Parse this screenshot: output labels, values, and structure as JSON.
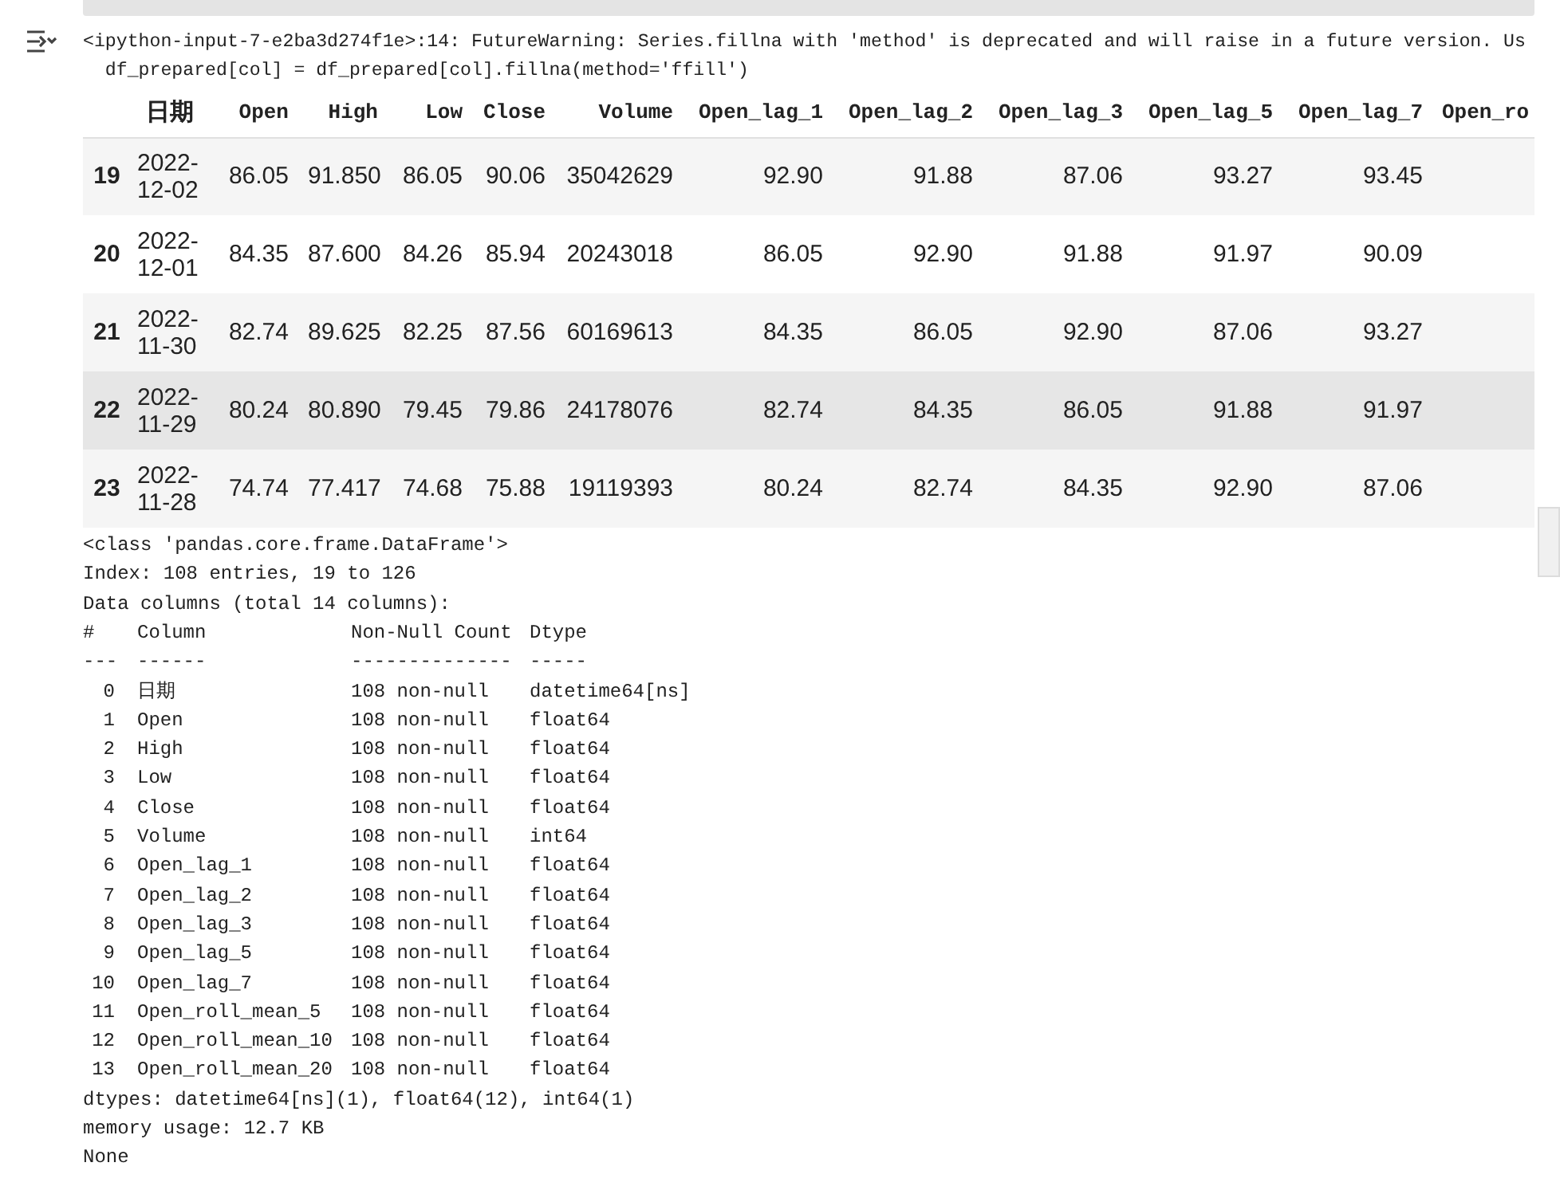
{
  "warning": {
    "lines": [
      "<ipython-input-7-e2ba3d274f1e>:14: FutureWarning: Series.fillna with 'method' is deprecated and will raise in a future version. Us",
      "  df_prepared[col] = df_prepared[col].fillna(method='ffill')"
    ]
  },
  "table": {
    "columns": [
      "",
      "日期",
      "Open",
      "High",
      "Low",
      "Close",
      "Volume",
      "Open_lag_1",
      "Open_lag_2",
      "Open_lag_3",
      "Open_lag_5",
      "Open_lag_7",
      "Open_ro"
    ],
    "rows": [
      {
        "highlighted": false,
        "cells": [
          "19",
          "2022-12-02",
          "86.05",
          "91.850",
          "86.05",
          "90.06",
          "35042629",
          "92.90",
          "91.88",
          "87.06",
          "93.27",
          "93.45"
        ]
      },
      {
        "highlighted": false,
        "cells": [
          "20",
          "2022-12-01",
          "84.35",
          "87.600",
          "84.26",
          "85.94",
          "20243018",
          "86.05",
          "92.90",
          "91.88",
          "91.97",
          "90.09"
        ]
      },
      {
        "highlighted": false,
        "cells": [
          "21",
          "2022-11-30",
          "82.74",
          "89.625",
          "82.25",
          "87.56",
          "60169613",
          "84.35",
          "86.05",
          "92.90",
          "87.06",
          "93.27"
        ]
      },
      {
        "highlighted": true,
        "cells": [
          "22",
          "2022-11-29",
          "80.24",
          "80.890",
          "79.45",
          "79.86",
          "24178076",
          "82.74",
          "84.35",
          "86.05",
          "91.88",
          "91.97"
        ]
      },
      {
        "highlighted": false,
        "cells": [
          "23",
          "2022-11-28",
          "74.74",
          "77.417",
          "74.68",
          "75.88",
          "19119393",
          "80.24",
          "82.74",
          "84.35",
          "92.90",
          "87.06"
        ]
      }
    ]
  },
  "info": {
    "header_lines": [
      "<class 'pandas.core.frame.DataFrame'>",
      "Index: 108 entries, 19 to 126",
      "Data columns (total 14 columns):"
    ],
    "column_header": [
      "#",
      "Column",
      "Non-Null Count",
      "Dtype"
    ],
    "rule": [
      "---",
      "------",
      "--------------",
      "-----"
    ],
    "columns": [
      {
        "num": "0",
        "name": "日期",
        "count": "108 non-null",
        "dtype": "datetime64[ns]"
      },
      {
        "num": "1",
        "name": "Open",
        "count": "108 non-null",
        "dtype": "float64"
      },
      {
        "num": "2",
        "name": "High",
        "count": "108 non-null",
        "dtype": "float64"
      },
      {
        "num": "3",
        "name": "Low",
        "count": "108 non-null",
        "dtype": "float64"
      },
      {
        "num": "4",
        "name": "Close",
        "count": "108 non-null",
        "dtype": "float64"
      },
      {
        "num": "5",
        "name": "Volume",
        "count": "108 non-null",
        "dtype": "int64"
      },
      {
        "num": "6",
        "name": "Open_lag_1",
        "count": "108 non-null",
        "dtype": "float64"
      },
      {
        "num": "7",
        "name": "Open_lag_2",
        "count": "108 non-null",
        "dtype": "float64"
      },
      {
        "num": "8",
        "name": "Open_lag_3",
        "count": "108 non-null",
        "dtype": "float64"
      },
      {
        "num": "9",
        "name": "Open_lag_5",
        "count": "108 non-null",
        "dtype": "float64"
      },
      {
        "num": "10",
        "name": "Open_lag_7",
        "count": "108 non-null",
        "dtype": "float64"
      },
      {
        "num": "11",
        "name": "Open_roll_mean_5",
        "count": "108 non-null",
        "dtype": "float64"
      },
      {
        "num": "12",
        "name": "Open_roll_mean_10",
        "count": "108 non-null",
        "dtype": "float64"
      },
      {
        "num": "13",
        "name": "Open_roll_mean_20",
        "count": "108 non-null",
        "dtype": "float64"
      }
    ],
    "footer_lines": [
      "dtypes: datetime64[ns](1), float64(12), int64(1)",
      "memory usage: 12.7 KB",
      "None"
    ]
  }
}
